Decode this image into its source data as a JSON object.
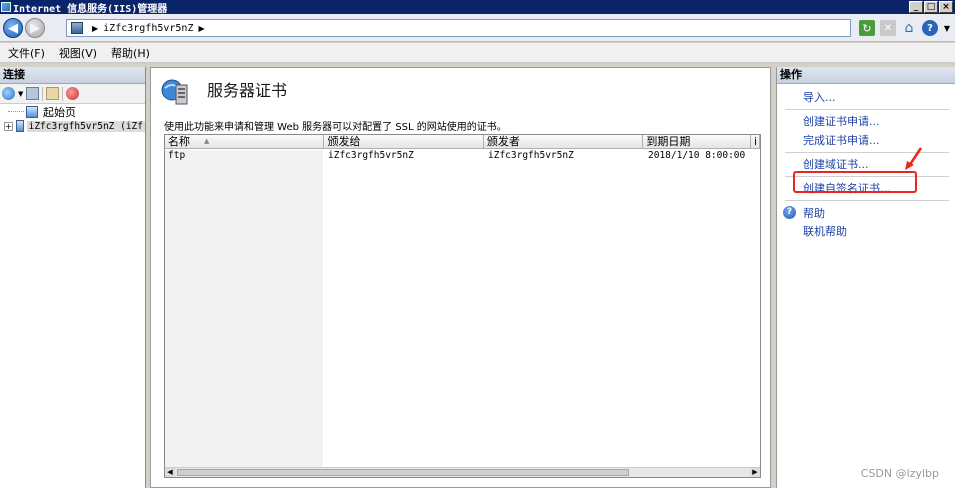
{
  "window": {
    "title": "Internet 信息服务(IIS)管理器",
    "controls": [
      "_",
      "□",
      "×"
    ]
  },
  "address": {
    "path_item": "iZfc3rgfh5vr5nZ"
  },
  "menu": {
    "items": [
      "文件(F)",
      "视图(V)",
      "帮助(H)"
    ]
  },
  "connections": {
    "header": "连接",
    "tree": [
      {
        "label": "起始页"
      },
      {
        "label": "iZfc3rgfh5vr5nZ (iZf",
        "expander": "+"
      }
    ]
  },
  "feature": {
    "title": "服务器证书",
    "description": "使用此功能来申请和管理 Web 服务器可以对配置了 SSL 的网站使用的证书。"
  },
  "grid": {
    "columns": [
      "名称",
      "颁发给",
      "颁发者",
      "到期日期",
      "i"
    ],
    "rows": [
      {
        "name": "ftp",
        "issued_to": "iZfc3rgfh5vr5nZ",
        "issued_by": "iZfc3rgfh5vr5nZ",
        "expires": "2018/1/10 8:00:00"
      }
    ]
  },
  "actions": {
    "header": "操作",
    "import_label": "导入...",
    "create_request_label": "创建证书申请...",
    "complete_request_label": "完成证书申请...",
    "create_domain_label": "创建域证书...",
    "create_self_signed_label": "创建自签名证书...",
    "help_label": "帮助",
    "online_help_label": "联机帮助"
  },
  "watermark": "CSDN @lzylbp",
  "colors": {
    "title_bar": "#0a246a",
    "action_link": "#1c3fa5",
    "highlight": "#e8261b"
  }
}
